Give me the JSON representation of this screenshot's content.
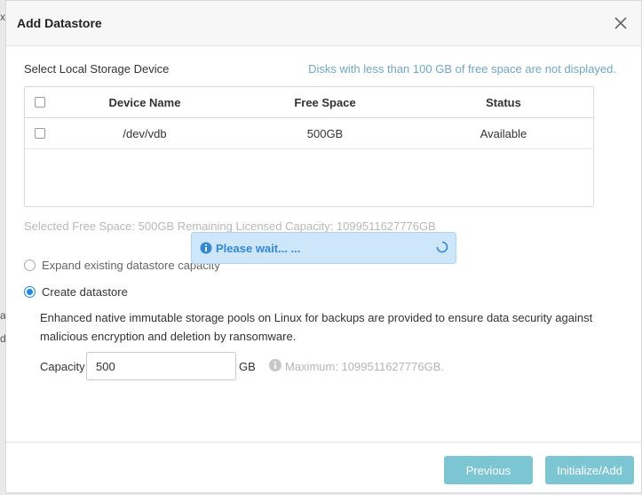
{
  "background": {
    "fragments": [
      "x",
      "a",
      "d"
    ]
  },
  "dialog": {
    "title": "Add Datastore",
    "section_label": "Select Local Storage Device",
    "hint": "Disks with less than 100 GB of free space are not displayed.",
    "table": {
      "headers": [
        "Device Name",
        "Free Space",
        "Status"
      ],
      "rows": [
        {
          "device": "/dev/vdb",
          "free": "500GB",
          "status": "Available"
        }
      ]
    },
    "summary": "Selected Free Space: 500GB Remaining Licensed Capacity: 1099511627776GB",
    "options": {
      "expand": "Expand existing datastore capacity",
      "create": "Create datastore"
    },
    "description": "Enhanced native immutable storage pools on Linux for backups are provided to ensure data security against malicious encryption and deletion by ransomware.",
    "capacity": {
      "label": "Capacity",
      "value": "500",
      "unit": "GB",
      "maximum": "Maximum: 1099511627776GB."
    },
    "buttons": {
      "previous": "Previous",
      "initialize": "Initialize/Add"
    },
    "toast": "Please wait... ..."
  },
  "colors": {
    "accent": "#1e88e5",
    "button": "#7cc6d3",
    "toast_bg": "#cde6fa",
    "toast_text": "#3189d6",
    "hint": "#6ea7c7"
  },
  "icons": {
    "close": "close-icon",
    "info": "info-icon",
    "spinner": "spinner-icon"
  }
}
